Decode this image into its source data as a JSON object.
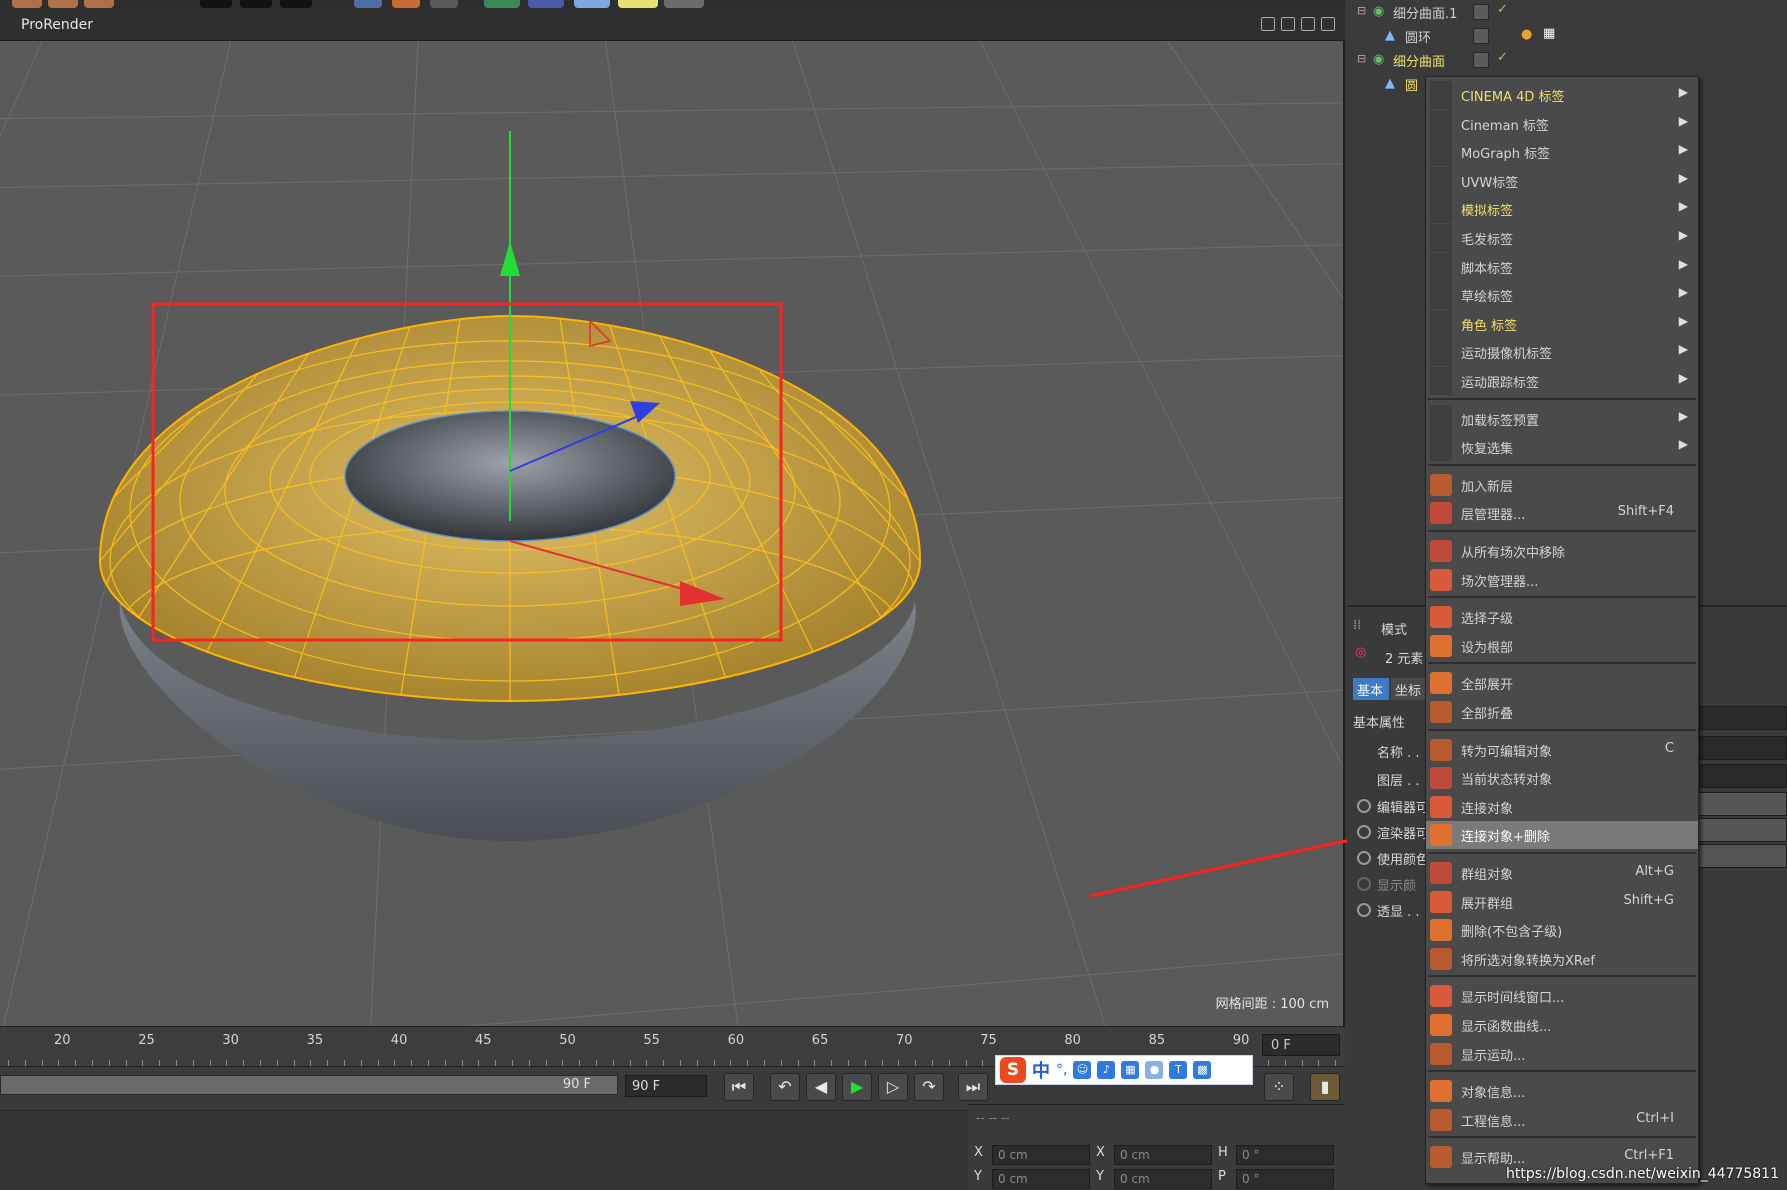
{
  "viewport": {
    "renderer": "ProRender",
    "grid_info": "网格间距 : 100 cm"
  },
  "timeline": {
    "ticks": [
      "20",
      "25",
      "30",
      "35",
      "40",
      "45",
      "50",
      "55",
      "60",
      "65",
      "70",
      "75",
      "80",
      "85",
      "90"
    ],
    "current_frame": "0 F",
    "scrub_end": "90 F",
    "end_frame": "90 F"
  },
  "coords": {
    "row1": {
      "a_label": "X",
      "a_val": "0 cm",
      "b_label": "X",
      "b_val": "0 cm",
      "c_label": "H",
      "c_val": "0 °"
    },
    "row2": {
      "a_label": "Y",
      "a_val": "0 cm",
      "b_label": "Y",
      "b_val": "0 cm",
      "c_label": "P",
      "c_val": "0 °"
    },
    "header": "-- -- --"
  },
  "ime": {
    "logo": "S",
    "lang": "中",
    "punct": "°,"
  },
  "object_manager": {
    "items": [
      {
        "name": "细分曲面.1",
        "color": "#d9d9d9"
      },
      {
        "name": "圆环",
        "color": "#d9d9d9"
      },
      {
        "name": "细分曲面",
        "color": "#f2df6f"
      },
      {
        "name": "圆",
        "color": "#f2df6f"
      }
    ]
  },
  "attribute_manager": {
    "mode": "模式",
    "elements": "2 元素",
    "tab_basic": "基本",
    "tab_coord": "坐标",
    "section": "基本属性",
    "fields": [
      "名称 . . .",
      "图层 . . ."
    ],
    "options": [
      "编辑器可",
      "渲染器可",
      "使用颜色",
      "显示颜",
      "透显 . ."
    ]
  },
  "context_menu": {
    "groups": [
      [
        {
          "label": "CINEMA 4D 标签",
          "arrow": "▶",
          "highlight": true
        },
        {
          "label": "Cineman 标签",
          "arrow": "▶"
        },
        {
          "label": "MoGraph 标签",
          "arrow": "▶"
        },
        {
          "label": "UVW标签",
          "arrow": "▶"
        },
        {
          "label": "模拟标签",
          "arrow": "▶",
          "highlight": true
        },
        {
          "label": "毛发标签",
          "arrow": "▶"
        },
        {
          "label": "脚本标签",
          "arrow": "▶"
        },
        {
          "label": "草绘标签",
          "arrow": "▶"
        },
        {
          "label": "角色 标签",
          "arrow": "▶",
          "highlight": true
        },
        {
          "label": "运动摄像机标签",
          "arrow": "▶"
        },
        {
          "label": "运动跟踪标签",
          "arrow": "▶"
        }
      ],
      [
        {
          "label": "加载标签预置",
          "arrow": "▶"
        },
        {
          "label": "恢复选集",
          "arrow": "▶"
        }
      ],
      [
        {
          "label": "加入新层",
          "icon": "layer-add-icon"
        },
        {
          "label": "层管理器...",
          "shortcut": "Shift+F4",
          "icon": "layer-manager-icon"
        }
      ],
      [
        {
          "label": "从所有场次中移除",
          "icon": "take-remove-icon"
        },
        {
          "label": "场次管理器...",
          "icon": "take-manager-icon"
        }
      ],
      [
        {
          "label": "选择子级",
          "icon": "select-children-icon"
        },
        {
          "label": "设为根部",
          "icon": "set-root-icon"
        }
      ],
      [
        {
          "label": "全部展开",
          "icon": "expand-all-icon"
        },
        {
          "label": "全部折叠",
          "icon": "collapse-all-icon"
        }
      ],
      [
        {
          "label": "转为可编辑对象",
          "shortcut": "C",
          "icon": "make-editable-icon"
        },
        {
          "label": "当前状态转对象",
          "icon": "current-state-icon"
        },
        {
          "label": "连接对象",
          "icon": "connect-objects-icon"
        },
        {
          "label": "连接对象+删除",
          "icon": "connect-delete-icon",
          "selected": true
        }
      ],
      [
        {
          "label": "群组对象",
          "shortcut": "Alt+G",
          "icon": "group-objects-icon"
        },
        {
          "label": "展开群组",
          "shortcut": "Shift+G",
          "icon": "expand-group-icon"
        },
        {
          "label": "删除(不包含子级)",
          "icon": "delete-no-children-icon"
        },
        {
          "label": "将所选对象转换为XRef",
          "icon": "xref-convert-icon"
        }
      ],
      [
        {
          "label": "显示时间线窗口...",
          "icon": "timeline-window-icon"
        },
        {
          "label": "显示函数曲线...",
          "icon": "fcurve-icon"
        },
        {
          "label": "显示运动...",
          "icon": "motion-icon"
        }
      ],
      [
        {
          "label": "对象信息...",
          "icon": "object-info-icon"
        },
        {
          "label": "工程信息...",
          "shortcut": "Ctrl+I",
          "icon": "project-info-icon"
        }
      ],
      [
        {
          "label": "显示帮助...",
          "shortcut": "Ctrl+F1",
          "icon": "help-icon"
        }
      ]
    ]
  },
  "watermark": "https://blog.csdn.net/weixin_44775811",
  "colors": {
    "accent_yellow": "#f2df6f",
    "selection_red": "#ff2020",
    "torus_yellow": "#c9a23a",
    "torus_gray": "#6e737a",
    "axis_green": "#22dd33",
    "axis_blue": "#2f3fdf",
    "axis_red": "#e33030"
  }
}
